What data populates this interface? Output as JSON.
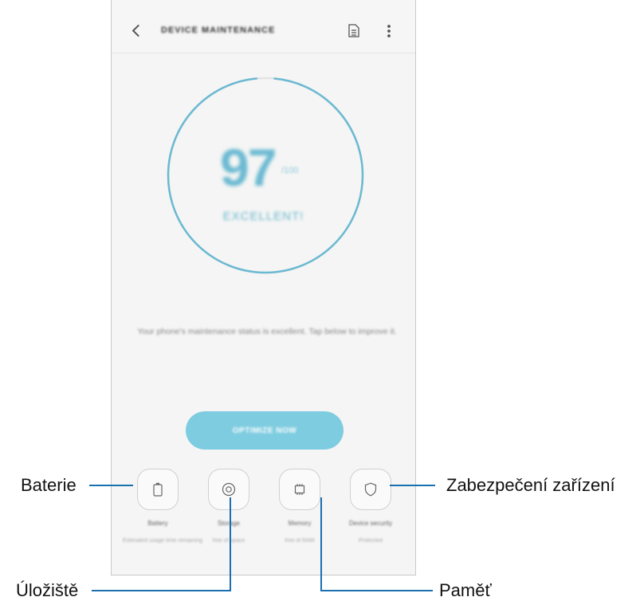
{
  "app": {
    "title": "DEVICE MAINTENANCE",
    "back_icon": "chevron-left-icon",
    "report_icon": "document-icon",
    "more_icon": "more-vertical-icon"
  },
  "score": {
    "value": "97",
    "unit": "/100",
    "status": "EXCELLENT!",
    "ring_fill_fraction": 0.97,
    "ring_color": "#6bb9d2"
  },
  "message": "Your phone's maintenance status is excellent. Tap below to improve it.",
  "optimize_button": {
    "label": "OPTIMIZE NOW",
    "color": "#7ecce0"
  },
  "categories": [
    {
      "label": "Battery",
      "sub": "Estimated usage time remaining",
      "icon": "battery-icon"
    },
    {
      "label": "Storage",
      "sub": "free of space",
      "icon": "storage-icon"
    },
    {
      "label": "Memory",
      "sub": "free of RAM",
      "icon": "memory-chip-icon"
    },
    {
      "label": "Device security",
      "sub": "Protected",
      "icon": "shield-icon"
    }
  ],
  "callouts": {
    "battery": "Baterie",
    "storage": "Úložiště",
    "memory": "Paměť",
    "security": "Zabezpečení zařízení"
  }
}
